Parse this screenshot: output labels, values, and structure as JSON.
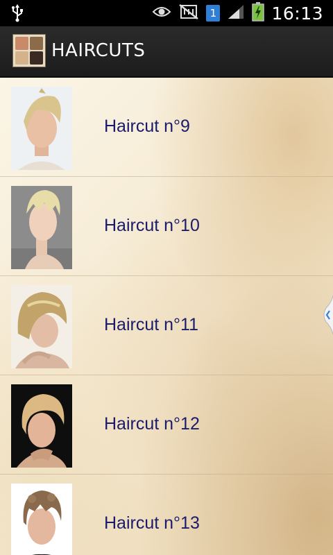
{
  "status_bar": {
    "time": "16:13",
    "sim_number": "1",
    "icons": [
      "usb-icon",
      "eye-icon",
      "no-sim-icon",
      "sim-icon",
      "signal-icon",
      "battery-charging-icon"
    ]
  },
  "action_bar": {
    "title": "HAIRCUTS",
    "icon": "app-collage-icon"
  },
  "list": {
    "items": [
      {
        "label": "Haircut n°9"
      },
      {
        "label": "Haircut n°10"
      },
      {
        "label": "Haircut n°11"
      },
      {
        "label": "Haircut n°12"
      },
      {
        "label": "Haircut n°13"
      }
    ]
  },
  "colors": {
    "label_text": "#1b1b6a",
    "action_bar": "#222222",
    "status_bar": "#000000",
    "sim_badge": "#2f7fd6",
    "battery": "#7cc242"
  }
}
